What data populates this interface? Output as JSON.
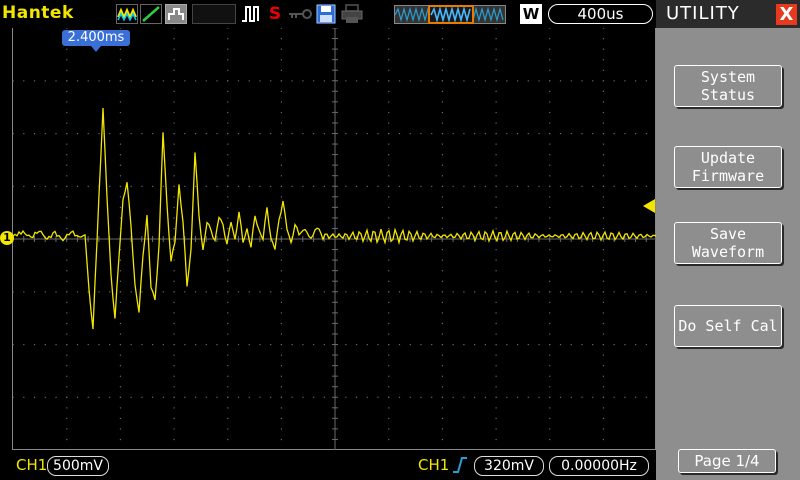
{
  "brand": "Hantek",
  "status_icons": {
    "s_indicator": "S",
    "wave_icon": "yellow-wave-icon",
    "line_icon": "green-line-icon",
    "gray_icon": "gray-box-icon",
    "trigger_icon": "trigger-pulse-icon",
    "key_icon": "key-icon",
    "disk_icon": "save-disk-icon",
    "printer_icon": "printer-icon"
  },
  "timebase": {
    "w_label": "W",
    "value": "400us"
  },
  "trigger_position": "2.400ms",
  "channel_marker": "1",
  "panel": {
    "title": "UTILITY",
    "close": "X",
    "buttons": [
      {
        "line1": "System",
        "line2": "Status"
      },
      {
        "line1": "Update",
        "line2": "Firmware"
      },
      {
        "line1": "Save",
        "line2": "Waveform"
      },
      {
        "line1": "Do Self Cal",
        "line2": ""
      }
    ],
    "page": "Page 1/4"
  },
  "bottom": {
    "ch1_label": "CH1",
    "volts_div": "500mV",
    "trig_channel": "CH1",
    "trig_level": "320mV",
    "frequency": "0.00000Hz"
  },
  "colors": {
    "trace": "#f2e600",
    "grid": "#6a6a6a",
    "marker": "#3a6fd8",
    "panel": "#8e8e8e",
    "close": "#e53a1e",
    "window": "#e87a00"
  }
}
